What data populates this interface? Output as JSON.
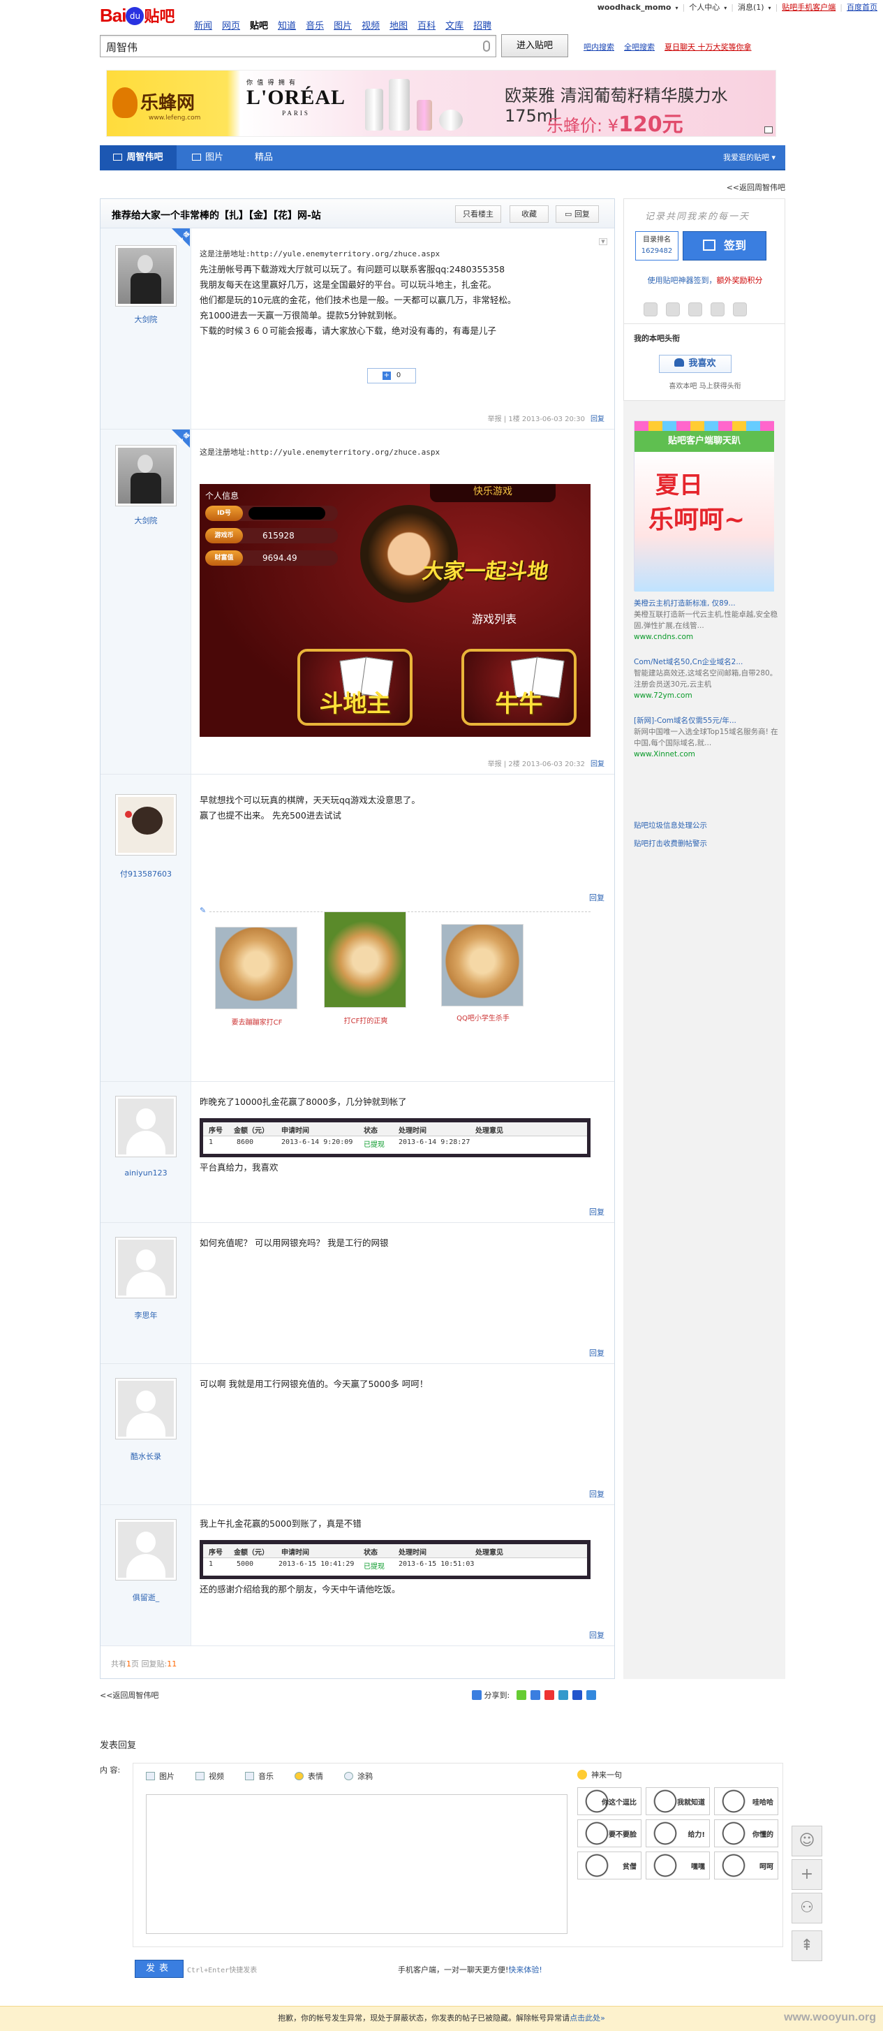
{
  "header": {
    "logo_text": "Bai",
    "logo_paw": "du",
    "logo_tieba": "贴吧",
    "nav": [
      "新闻",
      "网页",
      "贴吧",
      "知道",
      "音乐",
      "图片",
      "视频",
      "地图",
      "百科",
      "文库",
      "招聘"
    ],
    "nav_current": "贴吧",
    "user": {
      "username": "woodhack_momo",
      "personal_center": "个人中心",
      "messages": "消息(1)",
      "mobile_client": "贴吧手机客户端",
      "home": "百度首页"
    },
    "search": {
      "value": "周智伟",
      "button": "进入贴吧",
      "link_in_bar": "吧内搜索",
      "link_all": "全吧搜索",
      "link_promo": "夏日聊天 十万大奖等你拿"
    }
  },
  "ad": {
    "brand1": "乐蜂网",
    "brand1_url": "www.lefeng.com",
    "brand2_small": "你 值 得 拥 有",
    "brand2": "L'ORÉAL",
    "brand2_sub": "PARIS",
    "headline": "欧莱雅 清润葡萄籽精华膜力水175ml",
    "price_label": "乐蜂价: ¥",
    "price": "120元"
  },
  "forumbar": {
    "tabs": [
      "周智伟吧",
      "图片",
      "精品"
    ],
    "favorite": "我爱逛的贴吧"
  },
  "back_link": "<<返回周智伟吧",
  "thread": {
    "title": "推荐给大家一个非常棒的【扎】【金】【花】网-站",
    "btn_only_owner": "只看楼主",
    "btn_collect": "收藏",
    "btn_reply": "回复"
  },
  "posts": [
    {
      "user": "大剑院",
      "badge": "楼主",
      "url_line": "这是注册地址:http://yule.enemyterritory.org/zhuce.aspx",
      "lines": [
        "先注册帐号再下载游戏大厅就可以玩了。有问题可以联系客服qq:2480355358",
        "我朋友每天在这里赢好几万，这是全国最好的平台。可以玩斗地主，扎金花。",
        "他们都是玩的10元底的金花，他们技术也是一般。一天都可以赢几万，非常轻松。",
        "充1000进去一天赢一万很简单。提款5分钟就到帐。",
        "下载的时候３６０可能会报毒，请大家放心下载，绝对没有毒的，有毒是儿子"
      ],
      "like_count": "0",
      "meta": "举报 | 1楼 2013-06-03 20:30",
      "reply": "回复"
    },
    {
      "user": "大剑院",
      "badge": "楼主",
      "url_line": "这是注册地址:http://yule.enemyterritory.org/zhuce.aspx",
      "game": {
        "panel_title": "个人信息",
        "rows": [
          [
            "ID号",
            ""
          ],
          [
            "游戏币",
            "615928"
          ],
          [
            "财富值",
            "9694.49"
          ]
        ],
        "top_label": "快乐游戏",
        "slogan": "大家一起斗地",
        "list_label": "游戏列表",
        "btn1": "斗地主",
        "btn2": "牛牛"
      },
      "meta": "举报 | 2楼 2013-06-03 20:32",
      "reply": "回复"
    },
    {
      "user": "付913587603",
      "lines": [
        "早就想找个可以玩真的棋牌，天天玩qq游戏太没意思了。",
        "赢了也提不出来。  先充500进去试试"
      ],
      "reply": "回复",
      "dogs": [
        "要去蹦蹦家打CF",
        "打CF打的正爽",
        "QQ吧小学生杀手"
      ]
    },
    {
      "user": "ainiyun123",
      "line1": "昨晚充了10000扎金花赢了8000多，几分钟就到帐了",
      "table": {
        "headers": [
          "序号",
          "金额（元）",
          "申请时间",
          "状态",
          "处理时间",
          "处理意见"
        ],
        "row": [
          "1",
          "8600",
          "2013-6-14 9:20:09",
          "已提现",
          "2013-6-14 9:28:27",
          ""
        ]
      },
      "line2": "平台真给力，我喜欢",
      "reply": "回复"
    },
    {
      "user": "李思年",
      "line1": "如何充值呢？ 可以用网银充吗？ 我是工行的网银",
      "reply": "回复"
    },
    {
      "user": "酷水长录",
      "line1": "可以啊 我就是用工行网银充值的。今天赢了5000多 呵呵！",
      "reply": "回复"
    },
    {
      "user": "俱留逝_",
      "line1": "我上午扎金花赢的5000到账了，真是不错",
      "table": {
        "headers": [
          "序号",
          "金额（元）",
          "申请时间",
          "状态",
          "处理时间",
          "处理意见"
        ],
        "row": [
          "1",
          "5000",
          "2013-6-15 10:41:29",
          "已提现",
          "2013-6-15 10:51:03",
          ""
        ]
      },
      "line2": "还的感谢介绍给我的那个朋友，今天中午请他吃饭。",
      "reply": "回复"
    }
  ],
  "pager": {
    "prefix": "共有",
    "pages": "1",
    "mid": "页  回复贴:",
    "replies": "11"
  },
  "share": {
    "label": "分享到:"
  },
  "back_link2": "<<返回周智伟吧",
  "sidebar": {
    "slogan": "记录共同我来的每一天",
    "rank_label": "目录排名",
    "rank_value": "1629482",
    "sign_label": "签到",
    "tip": "使用贴吧神器签到，",
    "tip_red": "额外奖励积分",
    "like_title": "我的本吧头衔",
    "like_button": "我喜欢",
    "like_sub": "喜欢本吧  马上获得头衔",
    "ad_header": "贴吧客户端聊天趴",
    "ad_big1": "夏日",
    "ad_big2": "乐呵呵~",
    "text_ads": [
      {
        "t": "美橙云主机打造新标准, 仅89...",
        "d": "美橙互联打造新一代云主机,性能卓越,安全稳 固,弹性扩展,在线管...",
        "u": "www.cndns.com"
      },
      {
        "t": "Com/Net域名50,Cn企业域名2...",
        "d": "智能建站高效还,这域名空间邮箱,自带280。注册会员送30元,云主机",
        "u": "www.72ym.com"
      },
      {
        "t": "[新网]-Com域名仅需55元/年...",
        "d": "新网中国唯一入选全球Top15域名服务商! 在中国,每个国际域名,就...",
        "u": "www.Xinnet.com"
      }
    ],
    "links": [
      "贴吧垃圾信息处理公示",
      "贴吧打击收费删帖警示"
    ]
  },
  "editor": {
    "title": "发表回复",
    "label": "内  容:",
    "tools": [
      "图片",
      "视频",
      "音乐",
      "表情",
      "涂鸦"
    ],
    "emo_title": "神来一句",
    "emo_items": [
      "你这个逗比",
      "我就知道",
      "哇哈哈",
      "要不要脸",
      "给力!",
      "你懂的",
      "贫僧",
      "嘿嘿",
      "呵呵"
    ],
    "post_button": "发表",
    "hotkey": "Ctrl+Enter快捷发表",
    "mobile_tip": "手机客户端，一对一聊天更方便!",
    "mobile_link": "快来体验!"
  },
  "float_tools": [
    "☺",
    "+",
    "⚇",
    "⇞"
  ],
  "notice": {
    "text": "抱歉，你的帐号发生异常，现处于屏蔽状态，你发表的帖子已被隐藏。解除帐号异常请",
    "link": "点击此处»"
  },
  "watermark": "www.wooyun.org"
}
